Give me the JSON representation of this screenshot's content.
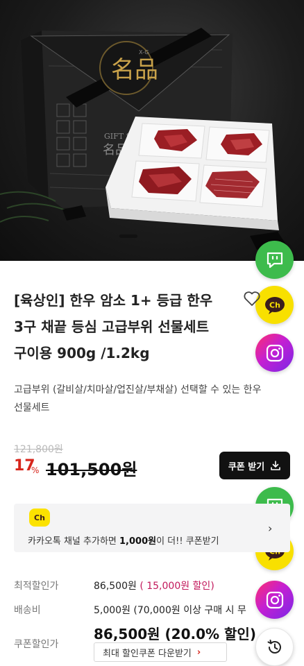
{
  "product": {
    "title_line1": "[육상인] 한우 암소 1+ 등급 한우",
    "title_line2": "3구 채끝 등심 고급부위 선물세트",
    "title_line3": "구이용 900g /1.2kg",
    "description_line1": "고급부위 (갈비살/치마살/업진살/부채살) 선택할 수 있는 한우",
    "description_line2": "선물세트",
    "box_label": "名品",
    "box_subtitle": "GIFT SET"
  },
  "pricing": {
    "original_price": "121,800원",
    "discount_rate": "17",
    "discount_unit": "%",
    "sale_price": "101,500원",
    "coupon_button_label": "쿠폰 받기"
  },
  "kakao_banner": {
    "logo_text": "Ch",
    "text_prefix": "카카오톡 채널 추가하면 ",
    "text_bold": "1,000원",
    "text_suffix": "이 더!! 쿠폰받기",
    "arrow": "›"
  },
  "info": {
    "best_price_label": "최적할인가",
    "best_price_value": "86,500원",
    "best_price_discount": "( 15,000원 할인)",
    "shipping_label": "배송비",
    "shipping_value": "5,000원 (70,000원 이상 구매 시 무",
    "coupon_price_label": "쿠폰할인가",
    "coupon_price_value": "86,500원 (20.0% 할인)",
    "best_coupon_button": "최대 할인쿠폰 다운받기",
    "best_coupon_chevron": "›"
  },
  "floating": {
    "ch_label": "Ch"
  },
  "colors": {
    "accent_red": "#d7261c",
    "talk_green": "#3dbb4c",
    "kakao_yellow": "#f8e000",
    "discount_pink": "#c2185b"
  },
  "icons": [
    "talk-icon",
    "kakao-channel-icon",
    "instagram-icon",
    "heart-icon",
    "download-icon",
    "history-icon"
  ]
}
